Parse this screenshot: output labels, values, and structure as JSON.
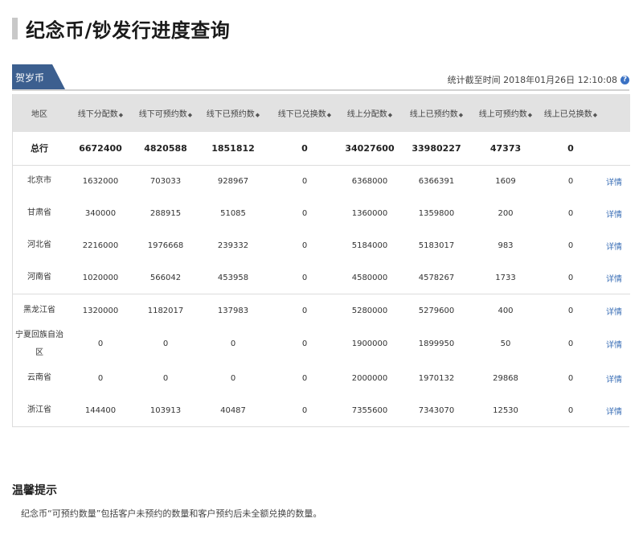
{
  "page_title": "纪念币/钞发行进度查询",
  "tab": {
    "label": "贺岁币"
  },
  "stat_time": "统计截至时间 2018年01月26日 12:10:08",
  "table": {
    "headers": [
      "地区",
      "线下分配数",
      "线下可预约数",
      "线下已预约数",
      "线下已兑换数",
      "线上分配数",
      "线上已预约数",
      "线上可预约数",
      "线上已兑换数"
    ],
    "sort_symbol": "◆",
    "total": [
      "总行",
      "6672400",
      "4820588",
      "1851812",
      "0",
      "34027600",
      "33980227",
      "47373",
      "0"
    ],
    "rows": [
      {
        "cells": [
          "北京市",
          "1632000",
          "703033",
          "928967",
          "0",
          "6368000",
          "6366391",
          "1609",
          "0"
        ],
        "detail": "详情"
      },
      {
        "cells": [
          "甘肃省",
          "340000",
          "288915",
          "51085",
          "0",
          "1360000",
          "1359800",
          "200",
          "0"
        ],
        "detail": "详情"
      },
      {
        "cells": [
          "河北省",
          "2216000",
          "1976668",
          "239332",
          "0",
          "5184000",
          "5183017",
          "983",
          "0"
        ],
        "detail": "详情"
      },
      {
        "cells": [
          "河南省",
          "1020000",
          "566042",
          "453958",
          "0",
          "4580000",
          "4578267",
          "1733",
          "0"
        ],
        "detail": "详情"
      },
      {
        "cells": [
          "黑龙江省",
          "1320000",
          "1182017",
          "137983",
          "0",
          "5280000",
          "5279600",
          "400",
          "0"
        ],
        "detail": "详情"
      },
      {
        "cells": [
          "宁夏回族自治区",
          "0",
          "0",
          "0",
          "0",
          "1900000",
          "1899950",
          "50",
          "0"
        ],
        "detail": "详情"
      },
      {
        "cells": [
          "云南省",
          "0",
          "0",
          "0",
          "0",
          "2000000",
          "1970132",
          "29868",
          "0"
        ],
        "detail": "详情"
      },
      {
        "cells": [
          "浙江省",
          "144400",
          "103913",
          "40487",
          "0",
          "7355600",
          "7343070",
          "12530",
          "0"
        ],
        "detail": "详情"
      }
    ]
  },
  "tips": {
    "title": "温馨提示",
    "text": "纪念币“可预约数量”包括客户未预约的数量和客户预约后未全额兑换的数量。"
  },
  "colors": {
    "tab_bg": "#3c5f8f",
    "header_bg": "#e2e2e2",
    "link": "#3b6fb6"
  }
}
